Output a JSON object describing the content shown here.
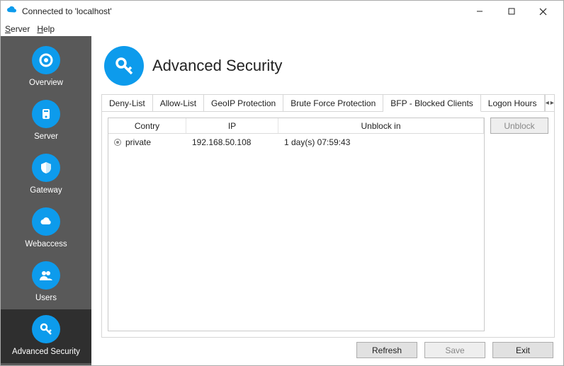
{
  "window": {
    "title": "Connected to 'localhost'"
  },
  "menu": {
    "server": "Server",
    "help": "Help"
  },
  "sidebar": {
    "items": [
      {
        "label": "Overview"
      },
      {
        "label": "Server"
      },
      {
        "label": "Gateway"
      },
      {
        "label": "Webaccess"
      },
      {
        "label": "Users"
      },
      {
        "label": "Advanced Security"
      }
    ]
  },
  "page": {
    "title": "Advanced Security"
  },
  "tabs": {
    "items": [
      {
        "label": "Deny-List"
      },
      {
        "label": "Allow-List"
      },
      {
        "label": "GeoIP Protection"
      },
      {
        "label": "Brute Force Protection"
      },
      {
        "label": "BFP - Blocked Clients"
      },
      {
        "label": "Logon Hours"
      }
    ],
    "activeIndex": 4
  },
  "grid": {
    "columns": [
      "Contry",
      "IP",
      "Unblock in"
    ],
    "rows": [
      {
        "country": "private",
        "ip": "192.168.50.108",
        "unblock_in": "1 day(s)  07:59:43"
      }
    ]
  },
  "actions": {
    "unblock": "Unblock"
  },
  "footer": {
    "refresh": "Refresh",
    "save": "Save",
    "exit": "Exit"
  }
}
